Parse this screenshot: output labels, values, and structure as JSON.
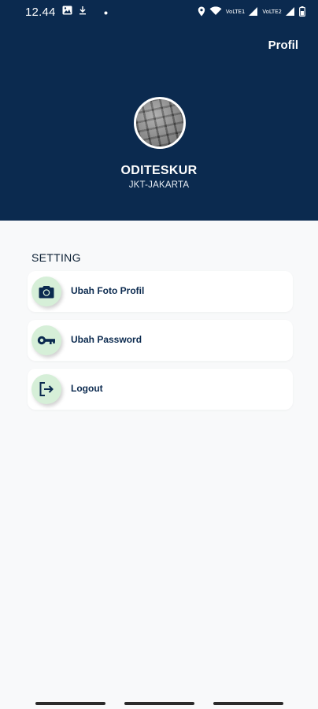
{
  "status_bar": {
    "time": "12.44",
    "network_labels": [
      "VoLTE1",
      "VoLTE2"
    ]
  },
  "header": {
    "title": "Profil",
    "user_name": "ODITESKUR",
    "user_location": "JKT-JAKARTA"
  },
  "settings": {
    "section_title": "SETTING",
    "items": [
      {
        "label": "Ubah Foto Profil",
        "icon": "camera-icon"
      },
      {
        "label": "Ubah Password",
        "icon": "key-icon"
      },
      {
        "label": "Logout",
        "icon": "logout-icon"
      }
    ]
  },
  "colors": {
    "header_bg": "#0b2a4f",
    "icon_circle": "#d6efd8",
    "page_bg": "#f8f9fa"
  }
}
